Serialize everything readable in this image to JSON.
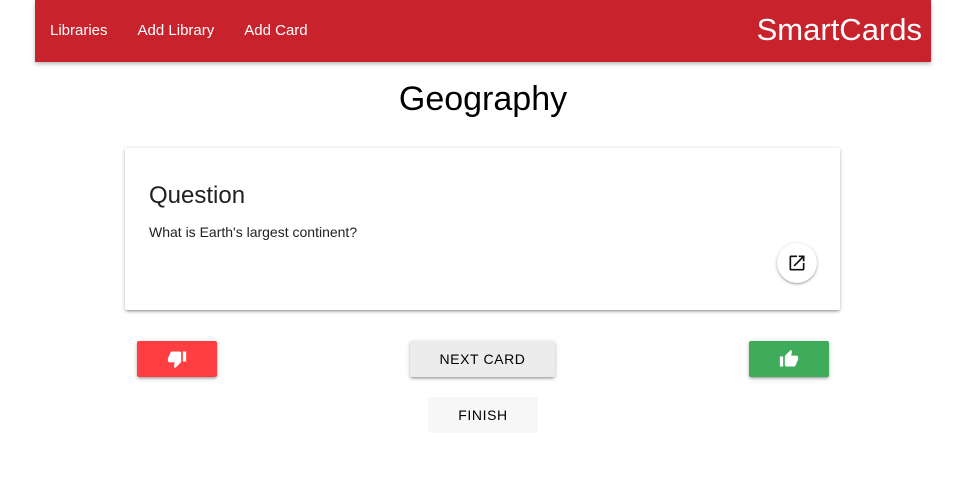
{
  "nav": {
    "links": [
      "Libraries",
      "Add Library",
      "Add Card"
    ],
    "brand": "SmartCards",
    "color": "#c8232c"
  },
  "page": {
    "title": "Geography"
  },
  "card": {
    "heading": "Question",
    "text": "What is Earth's largest continent?",
    "open_icon": "open-in-new-icon"
  },
  "actions": {
    "dislike_icon": "thumb-down-icon",
    "like_icon": "thumb-up-icon",
    "next_label": "NEXT CARD",
    "finish_label": "FINISH",
    "dislike_color": "#fe3e40",
    "like_color": "#3eac5b"
  }
}
